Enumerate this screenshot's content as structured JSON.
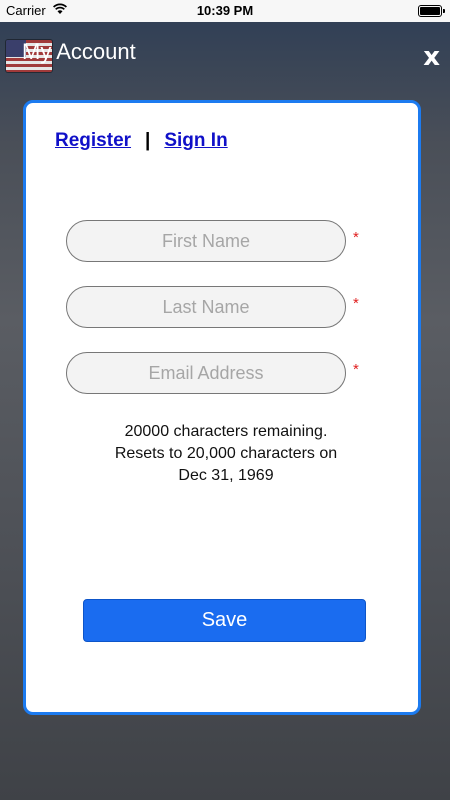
{
  "status_bar": {
    "carrier": "Carrier",
    "time": "10:39 PM"
  },
  "header": {
    "title": "My Account",
    "close_label": "x"
  },
  "auth": {
    "register": "Register",
    "separator": "|",
    "sign_in": "Sign In"
  },
  "form": {
    "first_name": {
      "placeholder": "First Name",
      "value": ""
    },
    "last_name": {
      "placeholder": "Last Name",
      "value": ""
    },
    "email": {
      "placeholder": "Email Address",
      "value": ""
    },
    "required_marker": "*"
  },
  "notice": {
    "line1": "20000 characters remaining.",
    "line2": "Resets to 20,000 characters on",
    "line3": "Dec 31, 1969"
  },
  "save_label": "Save",
  "colors": {
    "accent": "#1c7bf0",
    "button": "#1a6cf0",
    "link": "#1010c8",
    "required": "#e02020"
  }
}
